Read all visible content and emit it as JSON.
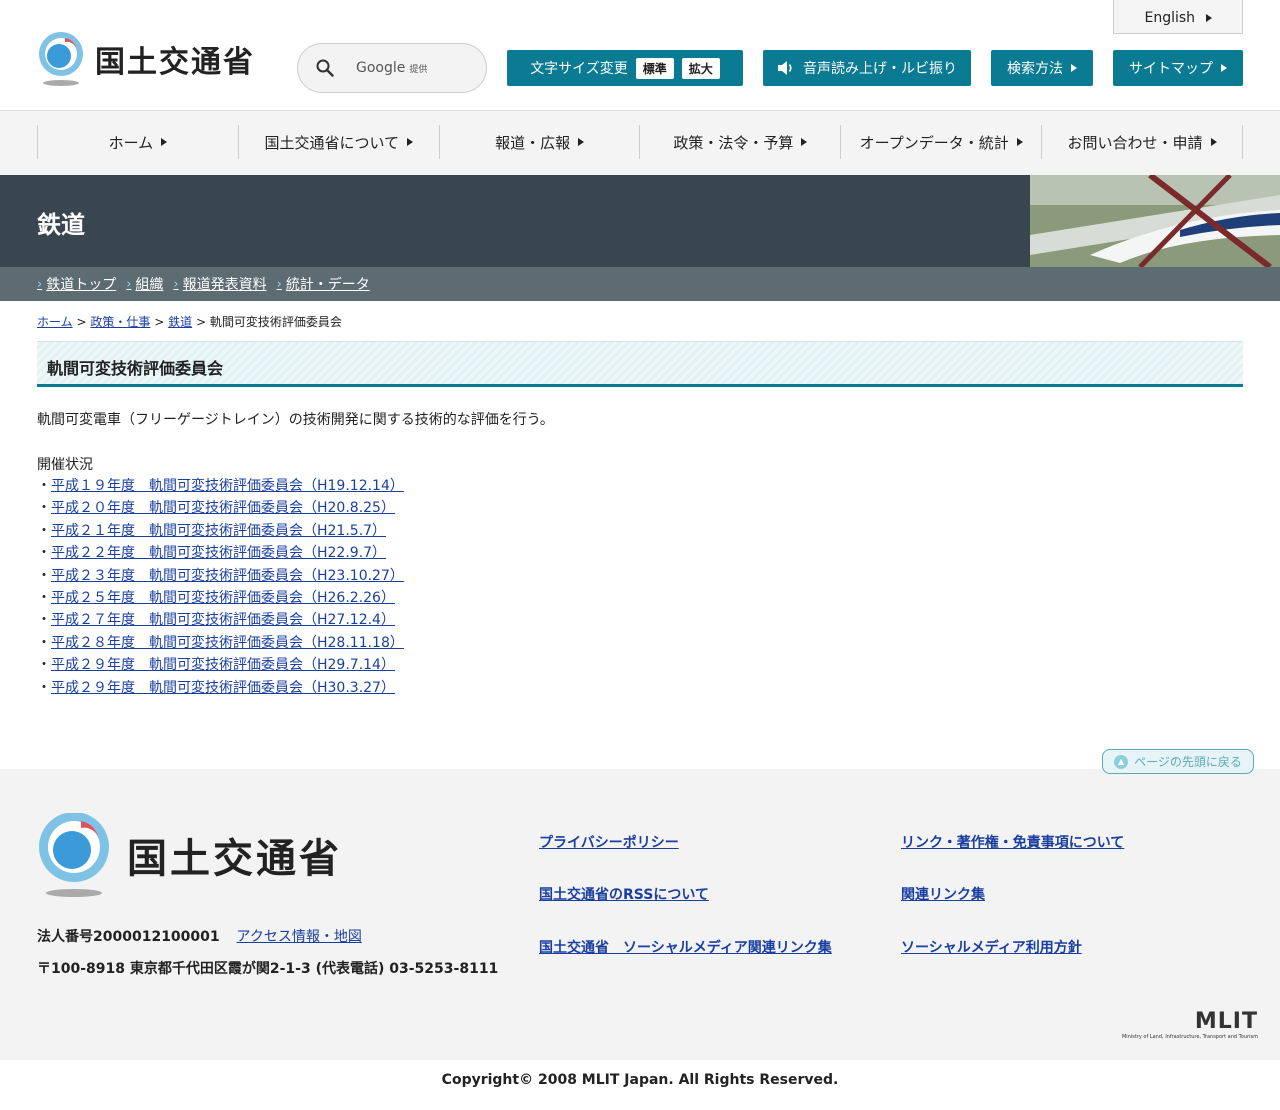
{
  "header": {
    "logo_text": "国土交通省",
    "english_label": "English",
    "search": {
      "brand": "Google",
      "sub": "提供"
    },
    "font_size_label": "文字サイズ変更",
    "font_size_standard": "標準",
    "font_size_large": "拡大",
    "speech_label": "音声読み上げ・ルビ振り",
    "search_method_label": "検索方法",
    "sitemap_label": "サイトマップ"
  },
  "gnav": {
    "items": [
      "ホーム",
      "国土交通省について",
      "報道・広報",
      "政策・法令・予算",
      "オープンデータ・統計",
      "お問い合わせ・申請"
    ]
  },
  "banner": {
    "title": "鉄道"
  },
  "subnav": {
    "items": [
      "鉄道トップ",
      "組織",
      "報道発表資料",
      "統計・データ"
    ]
  },
  "breadcrumb": {
    "home": "ホーム",
    "policy": "政策・仕事",
    "rail": "鉄道",
    "current": "軌間可変技術評価委員会",
    "sep": ">"
  },
  "page": {
    "title": "軌間可変技術評価委員会",
    "description": "軌間可変電車（フリーゲージトレイン）の技術開発に関する技術的な評価を行う。",
    "status_heading": "開催状況",
    "bullet": "・",
    "meetings": [
      "平成１９年度　軌間可変技術評価委員会（H19.12.14）",
      "平成２０年度　軌間可変技術評価委員会（H20.8.25）",
      "平成２１年度　軌間可変技術評価委員会（H21.5.7）",
      "平成２２年度　軌間可変技術評価委員会（H22.9.7）",
      "平成２３年度　軌間可変技術評価委員会（H23.10.27）",
      "平成２５年度　軌間可変技術評価委員会（H26.2.26）",
      "平成２７年度　軌間可変技術評価委員会（H27.12.4）",
      "平成２８年度　軌間可変技術評価委員会（H28.11.18）",
      "平成２９年度　軌間可変技術評価委員会（H29.7.14）",
      "平成２９年度　軌間可変技術評価委員会（H30.3.27）"
    ],
    "to_top": "ページの先頭に戻る"
  },
  "footer": {
    "logo_text": "国土交通省",
    "corp_number": "法人番号2000012100001",
    "access": "アクセス情報・地図",
    "address": "〒100-8918 東京都千代田区霞が関2-1-3 (代表電話) 03-5253-8111",
    "links": {
      "privacy": "プライバシーポリシー",
      "copyright": "リンク・著作権・免責事項について",
      "rss": "国土交通省のRSSについて",
      "related": "関連リンク集",
      "social_links": "国土交通省　ソーシャルメディア関連リンク集",
      "social_policy": "ソーシャルメディア利用方針"
    },
    "mlit_logo": "MLIT",
    "mlit_sub": "Ministry of Land, Infrastructure, Transport and Tourism"
  },
  "copyright": "Copyright© 2008 MLIT Japan. All Rights Reserved.",
  "colors": {
    "accent": "#0b7a93",
    "banner": "#3a464f",
    "subnav": "#5d6b73",
    "link": "#1a3fa0"
  }
}
